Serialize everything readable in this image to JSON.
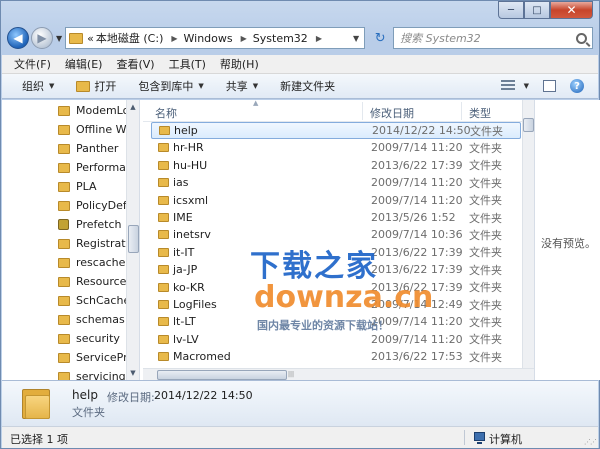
{
  "caption": {
    "minimize": "─",
    "maximize": "□",
    "close": "✕"
  },
  "nav": {
    "back": "◀",
    "forward": "▶",
    "history": "▼"
  },
  "address": {
    "prefix": "«",
    "crumbs": [
      "本地磁盘 (C:)",
      "Windows",
      "System32"
    ],
    "separator": "▶",
    "dropdown": "▼",
    "refresh": "↻"
  },
  "search": {
    "placeholder": "搜索 System32"
  },
  "menu": [
    "文件(F)",
    "编辑(E)",
    "查看(V)",
    "工具(T)",
    "帮助(H)"
  ],
  "toolbar": {
    "organize": "组织",
    "open": "打开",
    "include_in_library": "包含到库中",
    "share": "共享",
    "new_folder": "新建文件夹",
    "arrow": "▼"
  },
  "tree": {
    "items": [
      {
        "label": "ModemLo",
        "locked": false
      },
      {
        "label": "Offline We",
        "locked": false
      },
      {
        "label": "Panther",
        "locked": false
      },
      {
        "label": "Performar",
        "locked": false
      },
      {
        "label": "PLA",
        "locked": false
      },
      {
        "label": "PolicyDefi",
        "locked": false
      },
      {
        "label": "Prefetch",
        "locked": true
      },
      {
        "label": "Registratio",
        "locked": false
      },
      {
        "label": "rescache",
        "locked": false
      },
      {
        "label": "Resources",
        "locked": false
      },
      {
        "label": "SchCache",
        "locked": false
      },
      {
        "label": "schemas",
        "locked": false
      },
      {
        "label": "security",
        "locked": false
      },
      {
        "label": "ServicePrc",
        "locked": false
      },
      {
        "label": "servicing",
        "locked": false
      }
    ],
    "scroll_up": "▲",
    "scroll_down": "▼"
  },
  "columns": {
    "name": "名称",
    "date": "修改日期",
    "type": "类型",
    "sort": "▲"
  },
  "files": [
    {
      "name": "help",
      "date": "2014/12/22 14:50",
      "type": "文件夹",
      "selected": true
    },
    {
      "name": "hr-HR",
      "date": "2009/7/14 11:20",
      "type": "文件夹",
      "selected": false
    },
    {
      "name": "hu-HU",
      "date": "2013/6/22 17:39",
      "type": "文件夹",
      "selected": false
    },
    {
      "name": "ias",
      "date": "2009/7/14 11:20",
      "type": "文件夹",
      "selected": false
    },
    {
      "name": "icsxml",
      "date": "2009/7/14 11:20",
      "type": "文件夹",
      "selected": false
    },
    {
      "name": "IME",
      "date": "2013/5/26 1:52",
      "type": "文件夹",
      "selected": false
    },
    {
      "name": "inetsrv",
      "date": "2009/7/14 10:36",
      "type": "文件夹",
      "selected": false
    },
    {
      "name": "it-IT",
      "date": "2013/6/22 17:39",
      "type": "文件夹",
      "selected": false
    },
    {
      "name": "ja-JP",
      "date": "2013/6/22 17:39",
      "type": "文件夹",
      "selected": false
    },
    {
      "name": "ko-KR",
      "date": "2013/6/22 17:39",
      "type": "文件夹",
      "selected": false
    },
    {
      "name": "LogFiles",
      "date": "2009/7/14 12:49",
      "type": "文件夹",
      "selected": false
    },
    {
      "name": "lt-LT",
      "date": "2009/7/14 11:20",
      "type": "文件夹",
      "selected": false
    },
    {
      "name": "lv-LV",
      "date": "2009/7/14 11:20",
      "type": "文件夹",
      "selected": false
    },
    {
      "name": "Macromed",
      "date": "2013/6/22 17:53",
      "type": "文件夹",
      "selected": false
    }
  ],
  "preview": {
    "text": "没有预览。"
  },
  "watermark": {
    "line1": "下载之家",
    "line2": "downza.cn",
    "line3": "国内最专业的资源下载站！"
  },
  "details": {
    "name": "help",
    "date_label": "修改日期:",
    "date": "2014/12/22 14:50",
    "type": "文件夹"
  },
  "status": {
    "selection": "已选择 1 项",
    "location": "计算机",
    "grip": "⋰⋰"
  },
  "hscroll_grip": "|||"
}
